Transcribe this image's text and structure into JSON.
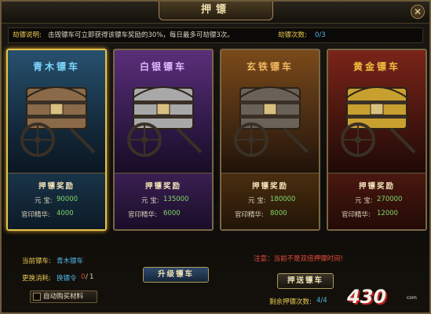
{
  "window": {
    "title": "押镖",
    "close_icon": "close-icon"
  },
  "info": {
    "label": "劫镖说明:",
    "text": "击毁镖车可立即获得该镖车奖励的30%，每日最多可劫镖3次。",
    "count_label": "劫镖次数:",
    "count_value": "0/3"
  },
  "cards": [
    {
      "name": "青木镖车",
      "name_color": "#7fd8ff",
      "theme": "blue",
      "reward_title": "押镖奖励",
      "ingot_label": "元 宝:",
      "ingot_value": "90000",
      "essence_label": "官印精华:",
      "essence_value": "4000",
      "selected": true
    },
    {
      "name": "白银镖车",
      "name_color": "#e0b8ff",
      "theme": "purple",
      "reward_title": "押镖奖励",
      "ingot_label": "元 宝:",
      "ingot_value": "135000",
      "essence_label": "官印精华:",
      "essence_value": "6000",
      "selected": false
    },
    {
      "name": "玄铁镖车",
      "name_color": "#f0b860",
      "theme": "orange",
      "reward_title": "押镖奖励",
      "ingot_label": "元 宝:",
      "ingot_value": "180000",
      "essence_label": "官印精华:",
      "essence_value": "8000",
      "selected": false
    },
    {
      "name": "黄金镖车",
      "name_color": "#f0c040",
      "theme": "red",
      "reward_title": "押镖奖励",
      "ingot_label": "元 宝:",
      "ingot_value": "270000",
      "essence_label": "官印精华:",
      "essence_value": "12000",
      "selected": false
    }
  ],
  "bottom": {
    "current_label": "当前镖车:",
    "current_value": "青木镖车",
    "swap_label": "更换消耗:",
    "swap_item": "换镖令",
    "swap_have": "0",
    "swap_sep": "/",
    "swap_need": "1",
    "upgrade_button": "升级镖车",
    "auto_buy_label": "自动购买材料",
    "warning": "注意：当前不是双倍押镖时间!",
    "escort_button": "押送镖车",
    "remaining_label": "剩余押镖次数:",
    "remaining_value": "4/4"
  },
  "logo": {
    "text": "430",
    "sub": "com"
  }
}
